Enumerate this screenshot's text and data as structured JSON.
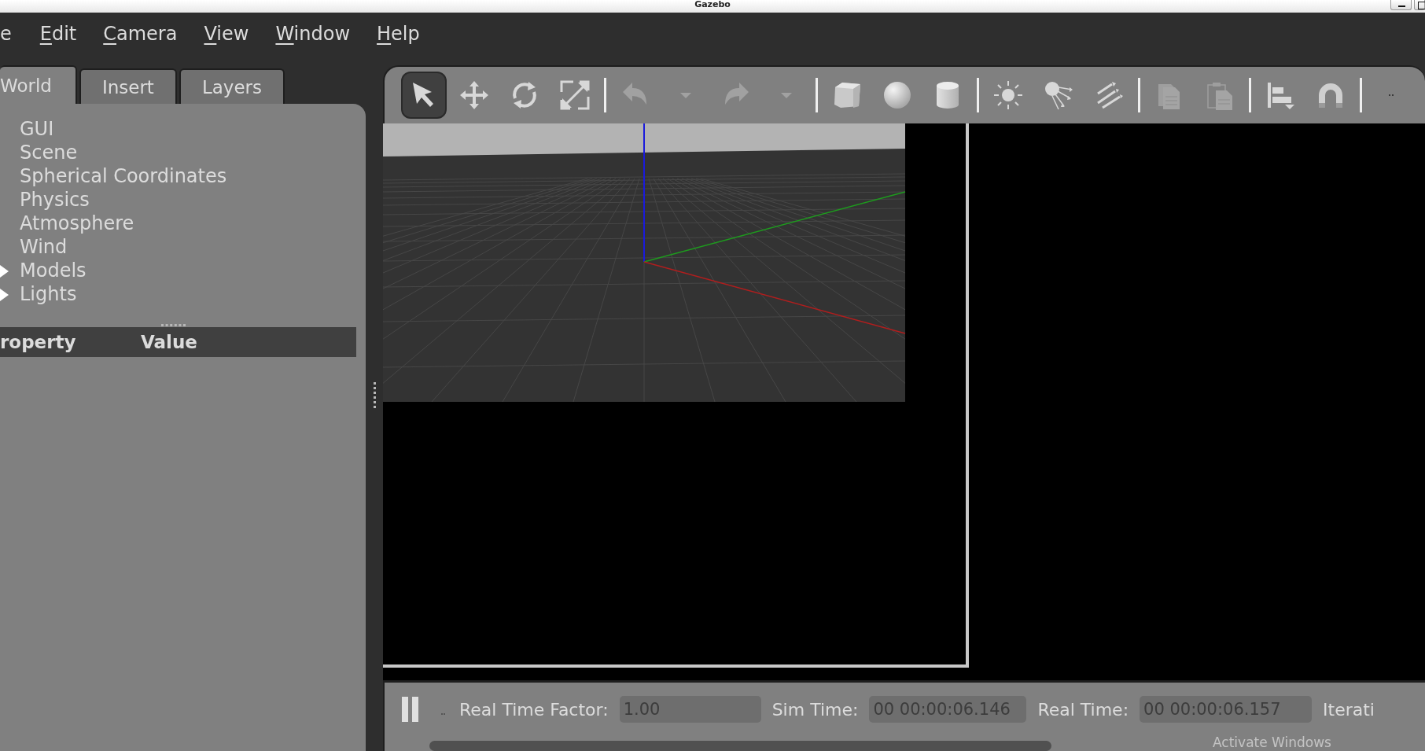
{
  "window": {
    "title": "Gazebo"
  },
  "menu": [
    {
      "label": "e",
      "underline_first": false
    },
    {
      "label": "Edit",
      "underline_first": true
    },
    {
      "label": "Camera",
      "underline_first": true
    },
    {
      "label": "View",
      "underline_first": true
    },
    {
      "label": "Window",
      "underline_first": true
    },
    {
      "label": "Help",
      "underline_first": true
    }
  ],
  "left_tabs": [
    {
      "label": "World",
      "selected": true
    },
    {
      "label": "Insert",
      "selected": false
    },
    {
      "label": "Layers",
      "selected": false
    }
  ],
  "world_tree": [
    {
      "label": "GUI",
      "expandable": false
    },
    {
      "label": "Scene",
      "expandable": false
    },
    {
      "label": "Spherical Coordinates",
      "expandable": false
    },
    {
      "label": "Physics",
      "expandable": false
    },
    {
      "label": "Atmosphere",
      "expandable": false
    },
    {
      "label": "Wind",
      "expandable": false
    },
    {
      "label": "Models",
      "expandable": true
    },
    {
      "label": "Lights",
      "expandable": true
    }
  ],
  "property_table": {
    "columns": [
      "roperty",
      "Value"
    ]
  },
  "toolbar": [
    {
      "kind": "tool",
      "selected": true,
      "disabled": false
    },
    {
      "kind": "tool",
      "selected": false,
      "disabled": false
    },
    {
      "kind": "tool",
      "selected": false,
      "disabled": false
    },
    {
      "kind": "tool",
      "selected": false,
      "disabled": false
    },
    {
      "kind": "separator"
    },
    {
      "kind": "tool",
      "selected": false,
      "disabled": true
    },
    {
      "kind": "dropdown",
      "selected": false,
      "disabled": true
    },
    {
      "kind": "tool",
      "selected": false,
      "disabled": true
    },
    {
      "kind": "dropdown",
      "selected": false,
      "disabled": true
    },
    {
      "kind": "separator"
    },
    {
      "kind": "tool",
      "selected": false,
      "disabled": false
    },
    {
      "kind": "tool",
      "selected": false,
      "disabled": false
    },
    {
      "kind": "tool",
      "selected": false,
      "disabled": false
    },
    {
      "kind": "separator"
    },
    {
      "kind": "tool",
      "selected": false,
      "disabled": false
    },
    {
      "kind": "tool",
      "selected": false,
      "disabled": false
    },
    {
      "kind": "tool",
      "selected": false,
      "disabled": false
    },
    {
      "kind": "separator"
    },
    {
      "kind": "tool",
      "selected": false,
      "disabled": true
    },
    {
      "kind": "tool",
      "selected": false,
      "disabled": true
    },
    {
      "kind": "separator"
    },
    {
      "kind": "tool",
      "selected": false,
      "disabled": false
    },
    {
      "kind": "tool",
      "selected": false,
      "disabled": false
    },
    {
      "kind": "separator"
    },
    {
      "kind": "overflow"
    }
  ],
  "status_bar": {
    "fields": [
      {
        "label": "Real Time Factor:",
        "value": "1.00"
      },
      {
        "label": "Sim Time:",
        "value": "00 00:00:06.146"
      },
      {
        "label": "Real Time:",
        "value": "00 00:00:06.157"
      }
    ],
    "cut_label": "Iterati",
    "notice": "Activate Windows"
  }
}
